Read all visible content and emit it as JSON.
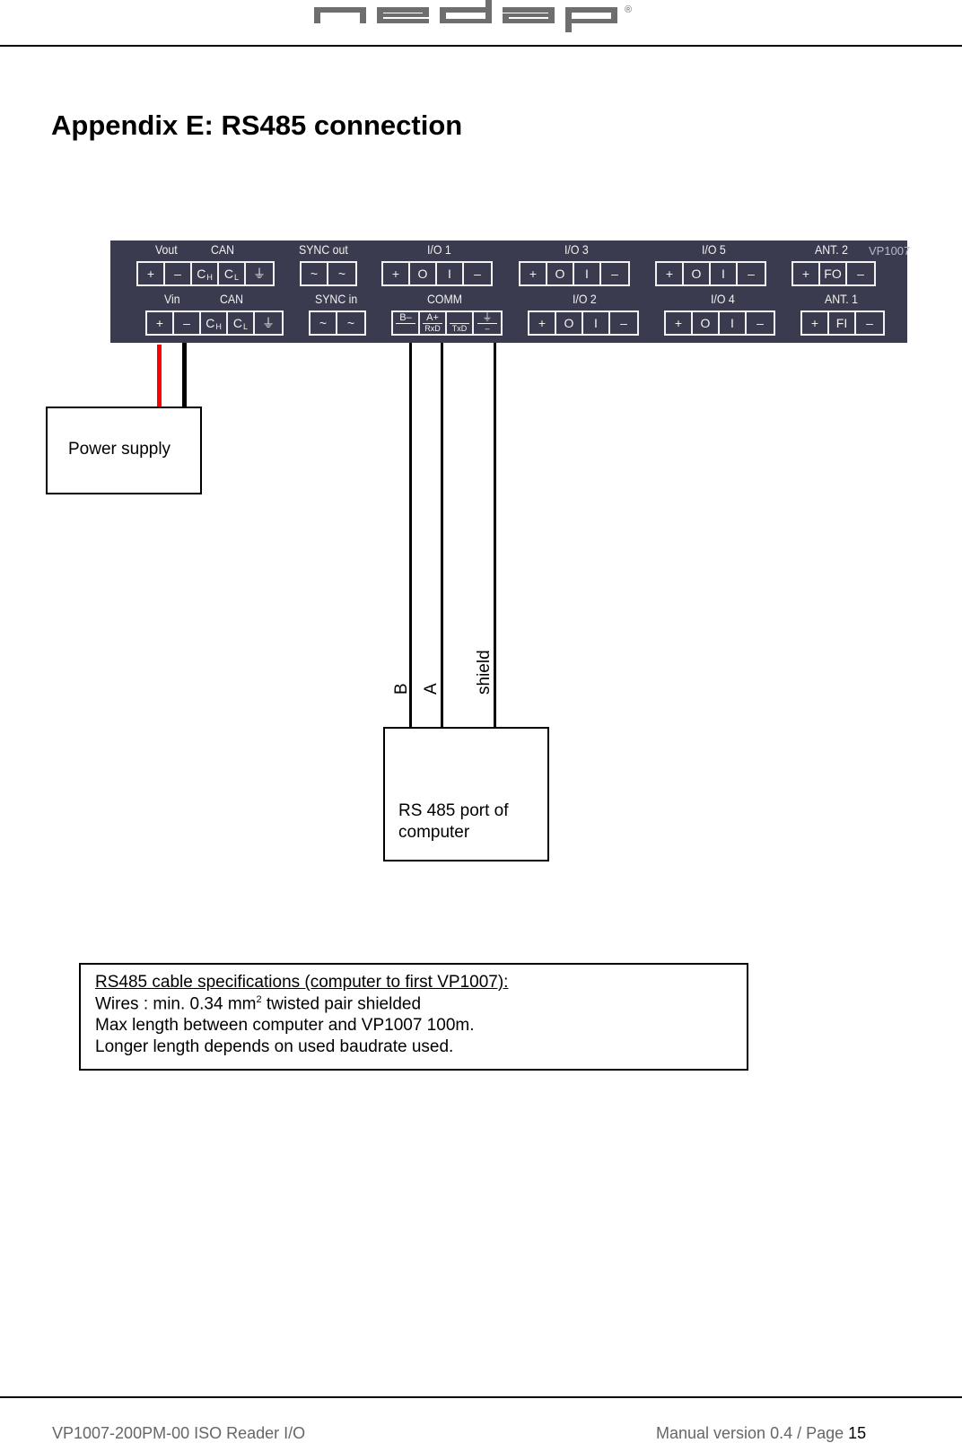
{
  "header": {
    "logo_text": "nedap",
    "logo_mark": "®",
    "logo_color": "#6e6e6e"
  },
  "page_title": "Appendix E: RS485 connection",
  "panel": {
    "model": "VP1007",
    "background": "#3b3b4f",
    "top_row": [
      {
        "label": "Vout",
        "sublabel": "CAN",
        "terminals": [
          "+",
          "–",
          "CH",
          "CL",
          "⏚"
        ]
      },
      {
        "label": "SYNC out",
        "terminals": [
          "~",
          "~"
        ]
      },
      {
        "label": "I/O 1",
        "terminals": [
          "+",
          "O",
          "I",
          "–"
        ]
      },
      {
        "label": "I/O 3",
        "terminals": [
          "+",
          "O",
          "I",
          "–"
        ]
      },
      {
        "label": "I/O  5",
        "terminals": [
          "+",
          "O",
          "I",
          "–"
        ]
      },
      {
        "label": "ANT. 2",
        "terminals": [
          "+",
          "FO",
          "–"
        ]
      }
    ],
    "bottom_row": [
      {
        "label": "Vin",
        "sublabel": "CAN",
        "terminals": [
          "+",
          "–",
          "CH",
          "CL",
          "⏚"
        ]
      },
      {
        "label": "SYNC in",
        "terminals": [
          "~",
          "~"
        ]
      },
      {
        "label": "COMM",
        "terminals": [
          {
            "top": "B–",
            "bottom": ""
          },
          {
            "top": "A+",
            "bottom": "RxD"
          },
          {
            "top": "",
            "bottom": "TxD"
          },
          {
            "top": "⏚",
            "bottom": "–"
          }
        ]
      },
      {
        "label": "I/O 2",
        "terminals": [
          "+",
          "O",
          "I",
          "–"
        ]
      },
      {
        "label": "I/O  4",
        "terminals": [
          "+",
          "O",
          "I",
          "–"
        ]
      },
      {
        "label": "ANT. 1",
        "terminals": [
          "+",
          "FI",
          "–"
        ]
      }
    ]
  },
  "diagram": {
    "power_supply_label": "Power supply",
    "power_wire_colors": [
      "#ff0000",
      "#000000"
    ],
    "rs485_box_label_line1": "RS 485 port of",
    "rs485_box_label_line2": "computer",
    "wire_labels": {
      "b": "B",
      "a": "A",
      "shield": "shield"
    }
  },
  "spec": {
    "title": "RS485 cable specifications (computer to first VP1007):",
    "wires_prefix": "Wires : min. 0.34 mm",
    "wires_sup": "2",
    "wires_suffix": " twisted pair shielded",
    "max_length": "Max length between computer and VP1007 100m.",
    "longer_length": "Longer length depends on used baudrate used."
  },
  "footer": {
    "document": "VP1007-200PM-00 ISO Reader I/O",
    "version": "Manual version 0.4 / Page ",
    "page": "15"
  }
}
